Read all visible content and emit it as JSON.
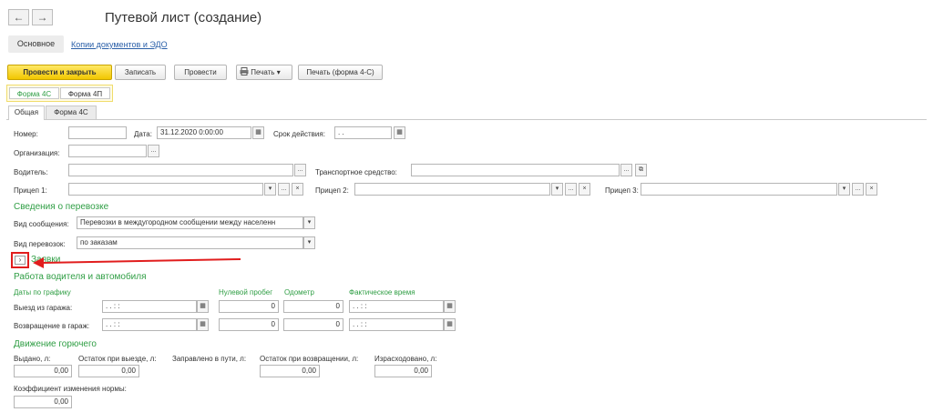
{
  "window": {
    "title": "Путевой лист (создание)",
    "back_icon": "←",
    "forward_icon": "→"
  },
  "nav": {
    "main": "Основное",
    "copies_link": "Копии документов и ЭДО"
  },
  "toolbar": {
    "post_close": "Провести и закрыть",
    "save": "Записать",
    "post": "Провести",
    "print": "Печать",
    "print_form": "Печать (форма 4-С)"
  },
  "form_switch": {
    "tab1": "Форма 4С",
    "tab2": "Форма 4П"
  },
  "tabs": {
    "general": "Общая",
    "form4c": "Форма 4С"
  },
  "header_fields": {
    "number_label": "Номер:",
    "number_value": "",
    "date_label": "Дата:",
    "date_value": "31.12.2020  0:00:00",
    "validity_label": "Срок действия:",
    "validity_value": " .  .",
    "org_label": "Организация:",
    "org_value": "",
    "driver_label": "Водитель:",
    "driver_value": "",
    "vehicle_label": "Транспортное средство:",
    "vehicle_value": "",
    "trailer1_label": "Прицеп 1:",
    "trailer2_label": "Прицеп 2:",
    "trailer3_label": "Прицеп 3:"
  },
  "transport": {
    "section": "Сведения о перевозке",
    "message_label": "Вид сообщения:",
    "message_value": "Перевозки в междугородном сообщении между населенн",
    "type_label": "Вид перевозок:",
    "type_value": "по заказам"
  },
  "orders": {
    "label": "Заявки",
    "toggle": "›"
  },
  "work": {
    "section": "Работа водителя и автомобиля",
    "schedule_col": "Даты по графику",
    "zero_run_col": "Нулевой пробег",
    "odometer_col": "Одометр",
    "actual_time_col": "Фактическое время",
    "departure_label": "Выезд из гаража:",
    "return_label": "Возвращение в гараж:",
    "date_placeholder": " .  .      :  :",
    "departure_zero_run": "0",
    "departure_odometer": "0",
    "return_zero_run": "0",
    "return_odometer": "0"
  },
  "fuel": {
    "section": "Движение горючего",
    "issued_label": "Выдано, л:",
    "issued_value": "0,00",
    "remain_out_label": "Остаток при выезде, л:",
    "remain_out_value": "0,00",
    "refuel_label": "Заправлено в пути, л:",
    "refuel_value": "0,00",
    "remain_back_label": "Остаток при возвращении, л:",
    "remain_back_value": "0,00",
    "spent_label": "Израсходовано, л:",
    "spent_value": "0,00",
    "coef_label": "Коэффициент изменения нормы:",
    "coef_value": "0,00"
  },
  "colors": {
    "accent_green": "#2f9e44",
    "link_blue": "#2a5fa8",
    "highlight_red": "#e11d1d",
    "primary_yellow": "#f2c700"
  },
  "icons": {
    "calendar": "calendar-icon",
    "select": "ellipsis-icon",
    "dropdown": "chevron-down-icon",
    "clear": "close-icon",
    "open": "open-icon",
    "print": "printer-icon"
  }
}
